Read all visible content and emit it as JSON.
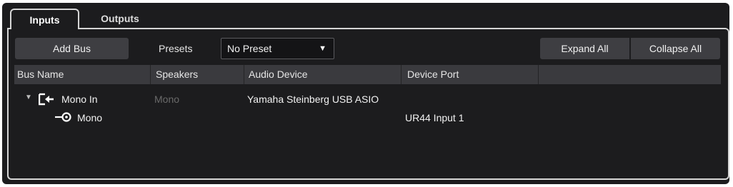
{
  "tabs": [
    {
      "label": "Inputs",
      "active": true
    },
    {
      "label": "Outputs",
      "active": false
    }
  ],
  "toolbar": {
    "add_bus_label": "Add Bus",
    "presets_label": "Presets",
    "preset_value": "No Preset",
    "expand_all_label": "Expand All",
    "collapse_all_label": "Collapse All"
  },
  "table": {
    "columns": [
      "Bus Name",
      "Speakers",
      "Audio Device",
      "Device Port",
      ""
    ],
    "rows": [
      {
        "bus_name": "Mono In",
        "speakers": "Mono",
        "audio_device": "Yamaha Steinberg USB ASIO",
        "device_port": "",
        "icon": "bus-input-icon",
        "expanded": true
      },
      {
        "bus_name": "Mono",
        "speakers": "",
        "audio_device": "",
        "device_port": "UR44 Input 1",
        "icon": "channel-input-icon"
      }
    ]
  },
  "colors": {
    "background": "#1c1c1e",
    "header": "#3a3a3e",
    "button": "#3e3e42",
    "dim_text": "#6a6a6a"
  }
}
